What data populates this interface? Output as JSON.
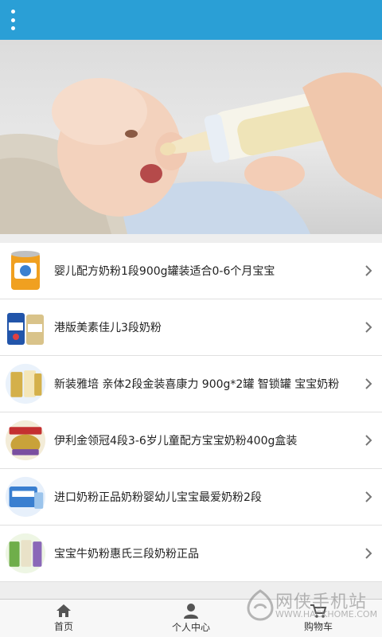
{
  "header": {
    "menu_icon": "more-vertical-icon",
    "color": "#2a9fd6"
  },
  "banner": {
    "dots": 3,
    "active_dot": 1
  },
  "products": [
    {
      "title": "婴儿配方奶粉1段900g罐装适合0-6个月宝宝",
      "thumb_color": "#f0a020"
    },
    {
      "title": "港版美素佳儿3段奶粉",
      "thumb_color": "#2255aa"
    },
    {
      "title": "新装雅培 亲体2段金装喜康力 900g*2罐 智锁罐 宝宝奶粉",
      "thumb_color": "#d4b04a"
    },
    {
      "title": "伊利金领冠4段3-6岁儿童配方宝宝奶粉400g盒装",
      "thumb_color": "#c9a23a"
    },
    {
      "title": "进口奶粉正品奶粉婴幼儿宝宝最爱奶粉2段",
      "thumb_color": "#3a7fd0"
    },
    {
      "title": "宝宝牛奶粉惠氏三段奶粉正品",
      "thumb_color": "#6fae4a"
    }
  ],
  "tabbar": {
    "tabs": [
      {
        "label": "首页",
        "icon": "home-icon"
      },
      {
        "label": "个人中心",
        "icon": "user-icon"
      },
      {
        "label": "购物车",
        "icon": "cart-icon"
      }
    ]
  },
  "watermark": {
    "line1": "网侠手机站",
    "line2": "WWW.HACKHOME.COM"
  }
}
